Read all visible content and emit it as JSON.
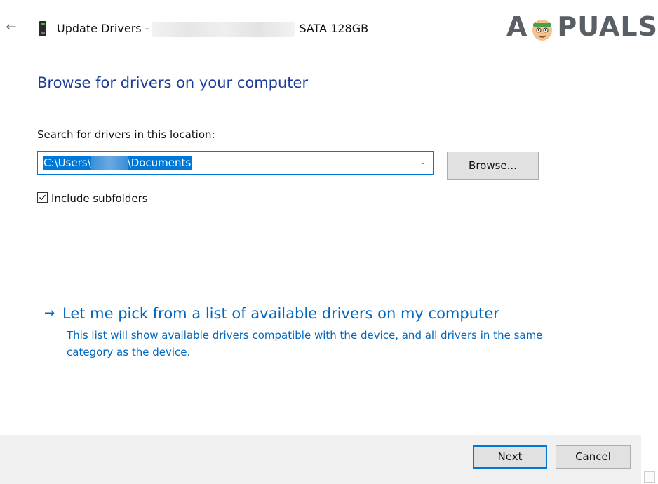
{
  "title_bar": {
    "title_prefix": "Update Drivers -",
    "title_suffix": "SATA 128GB",
    "back_icon": "back-arrow-icon",
    "device_icon": "drive-device-icon"
  },
  "watermark": {
    "text_left": "A",
    "text_right": "PUALS",
    "mascot_icon": "appuals-mascot-icon"
  },
  "main": {
    "heading": "Browse for drivers on your computer",
    "search_label": "Search for drivers in this location:",
    "path": {
      "part1": "C:\\Users\\",
      "part2": "\\Documents"
    },
    "browse_label": "Browse...",
    "include_subfolders": {
      "label": "Include subfolders",
      "checked": true
    },
    "pick_link": {
      "title": "Let me pick from a list of available drivers on my computer",
      "description": "This list will show available drivers compatible with the device, and all drivers in the same category as the device."
    }
  },
  "footer": {
    "next_label": "Next",
    "cancel_label": "Cancel"
  },
  "colors": {
    "heading": "#1c3d9a",
    "link": "#0067c0",
    "accent": "#0078d7",
    "footer_bg": "#f0f0f0",
    "button_bg": "#e1e1e1"
  }
}
